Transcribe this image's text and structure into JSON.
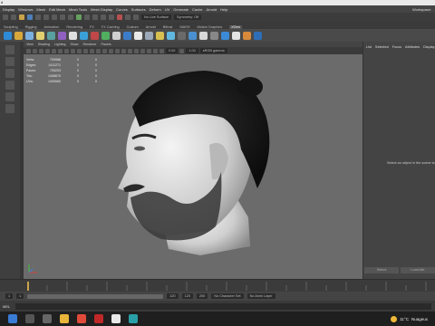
{
  "window": {
    "title": "d"
  },
  "menus": [
    "Display",
    "Windows",
    "Mesh",
    "Edit Mesh",
    "Mesh Tools",
    "Mesh Display",
    "Curves",
    "Surfaces",
    "Deform",
    "UV",
    "Generate",
    "Cache",
    "Arnold",
    "Help"
  ],
  "workspace_label": "Workspace:",
  "status_line": {
    "live_surface": "No Live Surface",
    "symmetry": "Symmetry: Off"
  },
  "shelf_tabs": [
    {
      "label": "Sculpting",
      "active": false
    },
    {
      "label": "Rigging",
      "active": false
    },
    {
      "label": "Animation",
      "active": false
    },
    {
      "label": "Rendering",
      "active": false
    },
    {
      "label": "FX",
      "active": false
    },
    {
      "label": "FX Caching",
      "active": false
    },
    {
      "label": "Custom",
      "active": false
    },
    {
      "label": "Arnold",
      "active": false
    },
    {
      "label": "Bifrost",
      "active": false
    },
    {
      "label": "MASH",
      "active": false
    },
    {
      "label": "Motion Graphics",
      "active": false
    },
    {
      "label": "XGen",
      "active": true
    }
  ],
  "panel_menu": [
    "View",
    "Shading",
    "Lighting",
    "Show",
    "Renderer",
    "Panels"
  ],
  "panel_bar": {
    "value1": "0.00",
    "value2": "1.00",
    "colorspace": "sRGB gamma"
  },
  "hud": {
    "rows": [
      {
        "label": "Verts:",
        "value": "709988",
        "c1": "0",
        "c2": "0"
      },
      {
        "label": "Edges:",
        "value": "1411271",
        "c1": "0",
        "c2": "0"
      },
      {
        "label": "Faces:",
        "value": "705203",
        "c1": "0",
        "c2": "0"
      },
      {
        "label": "Tris:",
        "value": "1408670",
        "c1": "0",
        "c2": "0"
      },
      {
        "label": "UVs:",
        "value": "1409060",
        "c1": "0",
        "c2": "0"
      }
    ]
  },
  "right_panel": {
    "tabs": [
      "List",
      "Selected",
      "Focus",
      "Attributes",
      "Display"
    ],
    "message": "Select an object in the scene to",
    "buttons": [
      "Select",
      "Load Attr"
    ]
  },
  "time_range": {
    "start": "1",
    "end": "120",
    "range_end": "120",
    "anim_end": "200"
  },
  "range_bar": {
    "character_set": "No Character Set",
    "anim_layer": "No Anim Layer"
  },
  "mel": {
    "label": "MEL"
  },
  "taskbar": {
    "temperature": "11°C",
    "condition": "Nuageux"
  },
  "colors": {
    "accent": "#c9a44a",
    "viewport": "#6b6b6b",
    "taskbar": "#1f1f1f"
  }
}
